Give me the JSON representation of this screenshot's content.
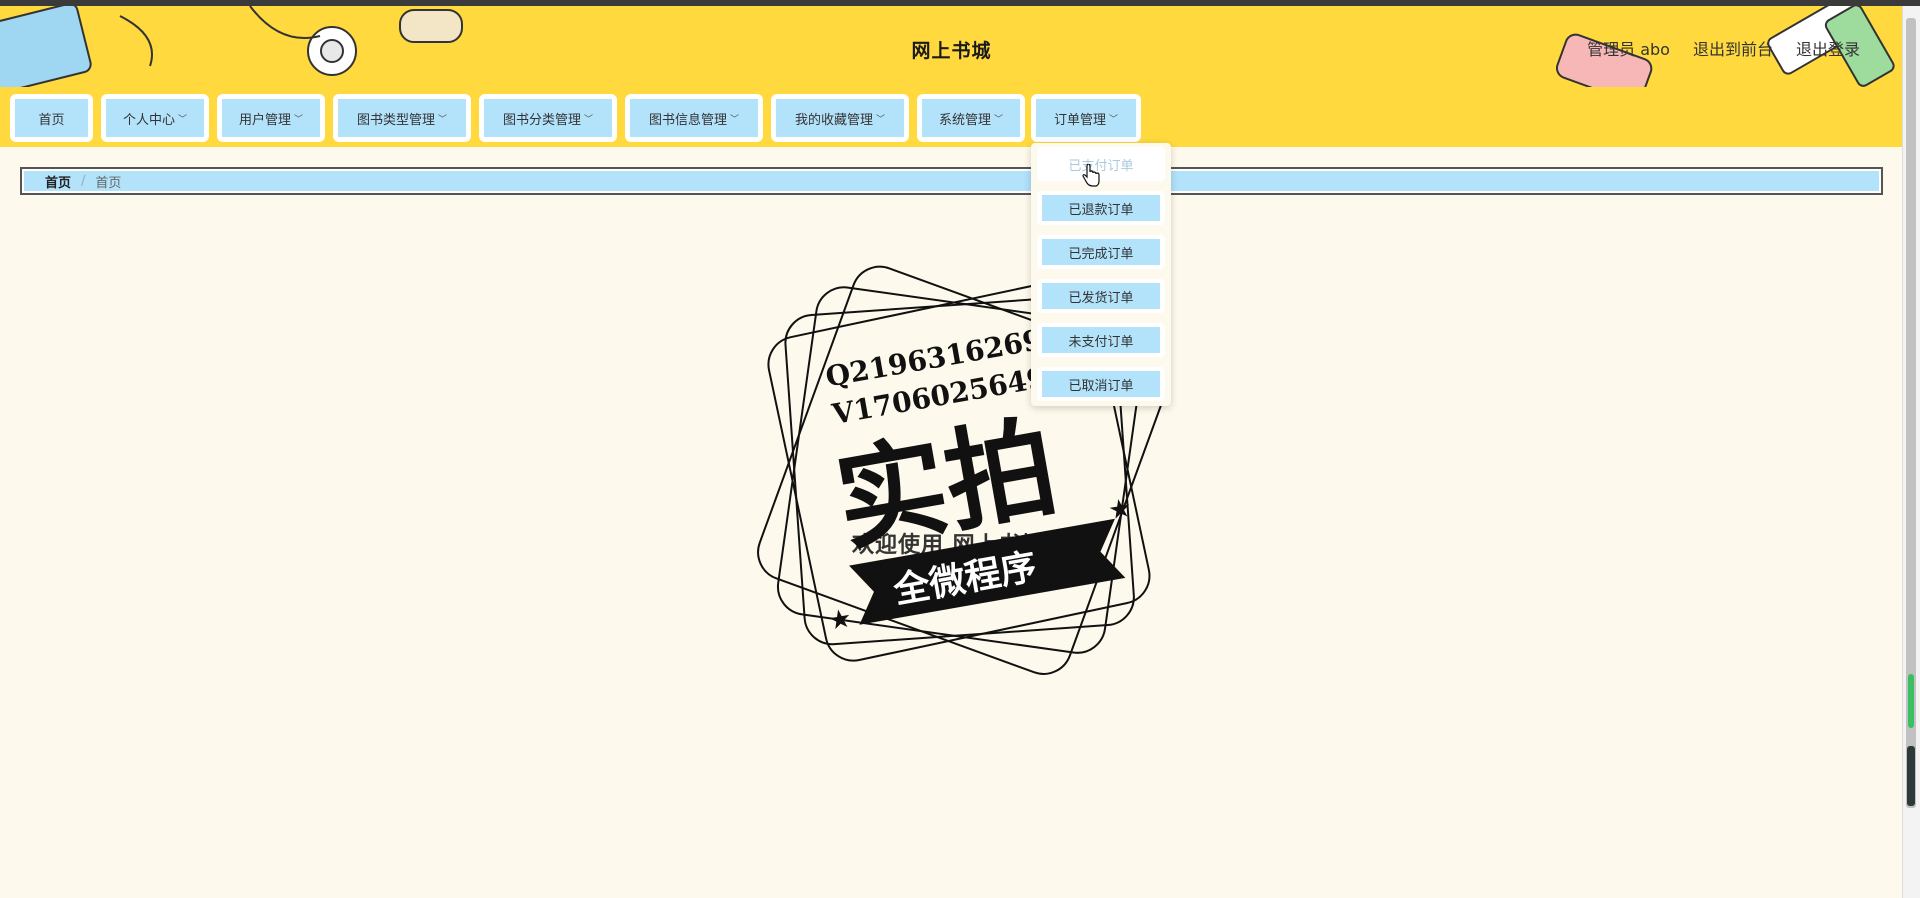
{
  "header": {
    "title": "网上书城",
    "admin_label": "管理员 abo",
    "back_to_front": "退出到前台",
    "logout": "退出登录"
  },
  "nav": {
    "items": [
      {
        "label": "首页",
        "dropdown": false
      },
      {
        "label": "个人中心",
        "dropdown": true
      },
      {
        "label": "用户管理",
        "dropdown": true
      },
      {
        "label": "图书类型管理",
        "dropdown": true
      },
      {
        "label": "图书分类管理",
        "dropdown": true
      },
      {
        "label": "图书信息管理",
        "dropdown": true
      },
      {
        "label": "我的收藏管理",
        "dropdown": true
      },
      {
        "label": "系统管理",
        "dropdown": true
      },
      {
        "label": "订单管理",
        "dropdown": true
      }
    ]
  },
  "dropdown": {
    "items": [
      "已支付订单",
      "已退款订单",
      "已完成订单",
      "已发货订单",
      "未支付订单",
      "已取消订单"
    ]
  },
  "breadcrumb": {
    "home": "首页",
    "separator": "/",
    "current": "首页"
  },
  "main": {
    "welcome": "欢迎使用 网上书城"
  },
  "watermark": {
    "line1": "Q2196316269",
    "line2": "V17060256499",
    "big": "实拍",
    "ribbon": "全微程序"
  },
  "colors": {
    "header_bg": "#ffd93d",
    "nav_item_bg": "#b3e2fb",
    "page_bg": "#fdf9ec"
  }
}
